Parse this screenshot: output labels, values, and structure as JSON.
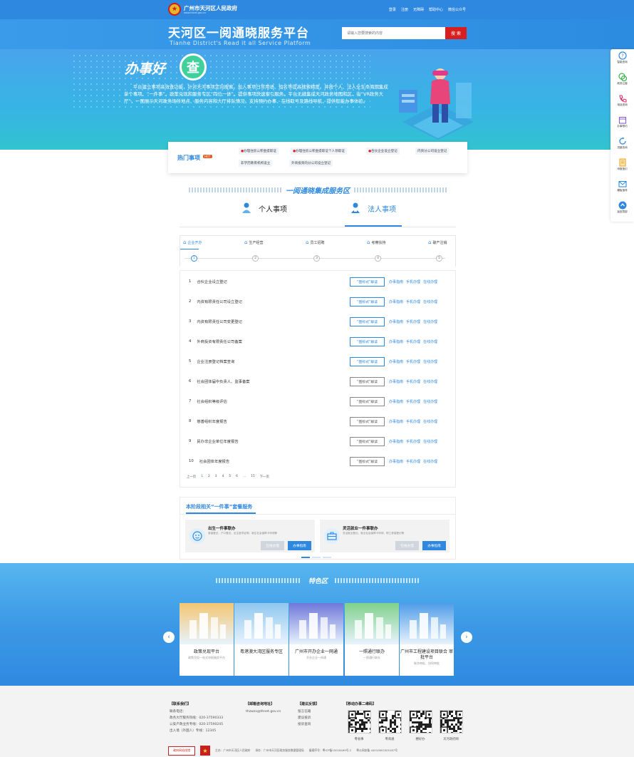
{
  "top": {
    "org_name": "广州市天河区人民政府",
    "org_url": "www.thnet.gov.cn",
    "links": [
      "登录",
      "注册",
      "无障碍",
      "帮助中心",
      "微信公众号"
    ]
  },
  "header": {
    "title": "天河区一阅通晓服务平台",
    "subtitle": "Tianhe District's  Read it all  Service Platform",
    "search_placeholder": "请输入您要搜索的内容",
    "search_button": "搜 索"
  },
  "banner": {
    "slogan": "办事好",
    "badge": "查",
    "description": "平台建立事项高效查功能，针对天河事项定向搜索。加入事项日常用语、短名等提高搜索精度。并按个人、法人全生命周期集成单个事项、“一件事”，政策兑现和服务专区“四位一体”，提供事项快速索引服务。平台无缝集成天河政务地图和区、街“VR政务大厅”，一图展示天河政务场所地点、服务内容和大厅排队情况，支持预约办事、在线取号及路线导航，提供智能办事体验。"
  },
  "float_bar": [
    {
      "label": "智能咨询",
      "icon": "question-icon",
      "color": "#2f88e0"
    },
    {
      "label": "政务云窗",
      "icon": "chat-icon",
      "color": "#3bb54a"
    },
    {
      "label": "电话咨询",
      "icon": "phone-icon",
      "color": "#e0306a"
    },
    {
      "label": "办事预约",
      "icon": "calendar-icon",
      "color": "#8a5cd6"
    },
    {
      "label": "进度查询",
      "icon": "progress-icon",
      "color": "#2f88e0"
    },
    {
      "label": "申报指引",
      "icon": "document-icon",
      "color": "#f0a020"
    },
    {
      "label": "模板指导",
      "icon": "mail-icon",
      "color": "#2f88e0"
    },
    {
      "label": "返回顶部",
      "icon": "top-icon",
      "color": "#2f88e0"
    }
  ],
  "hot": {
    "title": "热门事项",
    "tag": "HOT",
    "items": [
      "办理住房公积金提取证",
      "办理住房公积金提取证个人领取证",
      "合伙企业设立登记",
      "内资分公司设立登记",
      "非学历教育机构设立",
      "外商投资的分公司设立登记"
    ]
  },
  "zone": {
    "title": "一阅通晓集成服务区",
    "tabs": [
      "个人事项",
      "法人事项"
    ],
    "stages": [
      "企业开办",
      "生产经营",
      "员工招聘",
      "考察扶持",
      "破产注销"
    ],
    "stage_nums": [
      "1",
      "2",
      "3",
      "4",
      "5"
    ]
  },
  "list": [
    {
      "no": "1",
      "name": "合伙企业设立登记",
      "btn": "“图标式”解读",
      "blue": true
    },
    {
      "no": "2",
      "name": "内资有限责任公司设立登记",
      "btn": "“图标式”解读",
      "blue": true
    },
    {
      "no": "3",
      "name": "内资有限责任公司变更登记",
      "btn": "“图标式”解读",
      "blue": true
    },
    {
      "no": "4",
      "name": "外商投资有限责任公司备案",
      "btn": "“图标式”解读",
      "blue": true
    },
    {
      "no": "5",
      "name": "企业注册登记档案查询",
      "btn": "“图标式”解读",
      "blue": true
    },
    {
      "no": "6",
      "name": "社会团体届中负责人、监事备案",
      "btn": "“图标式”解读",
      "blue": false
    },
    {
      "no": "7",
      "name": "社会组织等级评估",
      "btn": "“图标式”解读",
      "blue": false
    },
    {
      "no": "8",
      "name": "慈善组织年度报告",
      "btn": "“图标式”解读",
      "blue": false
    },
    {
      "no": "9",
      "name": "民办非企业单位年度报告",
      "btn": "“图标式”解读",
      "blue": false
    },
    {
      "no": "10",
      "name": "社会团体年度报告",
      "btn": "“图标式”解读",
      "blue": false
    }
  ],
  "row_links": [
    "办事指南",
    "手机办理",
    "在线办理"
  ],
  "pager": [
    "上一页",
    "1",
    "2",
    "3",
    "4",
    "5",
    "6",
    "...",
    "15",
    "下一页"
  ],
  "package": {
    "title": "本阶段相关“一件事”套餐服务",
    "cards": [
      {
        "title": "出生一件事联办",
        "desc": "参保登记、户口登记、出生医学证明、新生社会保障卡申领等",
        "btn_online": "在线办理",
        "btn_guide": "办事指南"
      },
      {
        "title": "灵活就业一件事联办",
        "desc": "灵活就业登记、就业社会保障卡申领、职工参保登记等",
        "btn_online": "在线办理",
        "btn_guide": "办事指南"
      }
    ]
  },
  "special": {
    "title": "特色区",
    "cards": [
      {
        "title": "政策兑现平台",
        "sub": "政策兑现一站式申报服务平台",
        "color": "#f3c673"
      },
      {
        "title": "粤港澳大湾区服务专区",
        "sub": "",
        "color": "#8fc7ef"
      },
      {
        "title": "广州市开办企业一网通",
        "sub": "开办企业一网通",
        "color": "#6e78d9"
      },
      {
        "title": "一照通行联办",
        "sub": "一照通行联办",
        "color": "#7fd18b"
      },
      {
        "title": "广州市工程建设项目联合 审批平台",
        "sub": "联合审批、协同审批",
        "color": "#4f9ce8"
      }
    ]
  },
  "footer": {
    "contact_title": "【联系我们】",
    "contact_lines": [
      "联系电话：",
      "政务大厅服务热线：020-37590333",
      "公安户政业务专线：020-37590245",
      "出入境（外国人）专线：12345"
    ],
    "mail_title": "【邮箱咨询地址】",
    "mail": "thzwzx@thnet.gov.cn",
    "suggest_title": "【建议反馈】",
    "suggest_lines": [
      "留言信箱",
      "建议投诉",
      "投诉查询"
    ],
    "qr_title": "【移动办事二维码】",
    "qr_labels": [
      "粤省事",
      "粤商通",
      "穗好办",
      "天河政府网"
    ],
    "bar": [
      "主办：广州市天河区人民政府",
      "承办：广州市天河区政务服务数据管理局",
      "备案序号：粤ICP备15016469号-2",
      "粤公网安备 44010602000187号"
    ],
    "badge1": "政府网站找错",
    "badge2": "党政机关"
  }
}
